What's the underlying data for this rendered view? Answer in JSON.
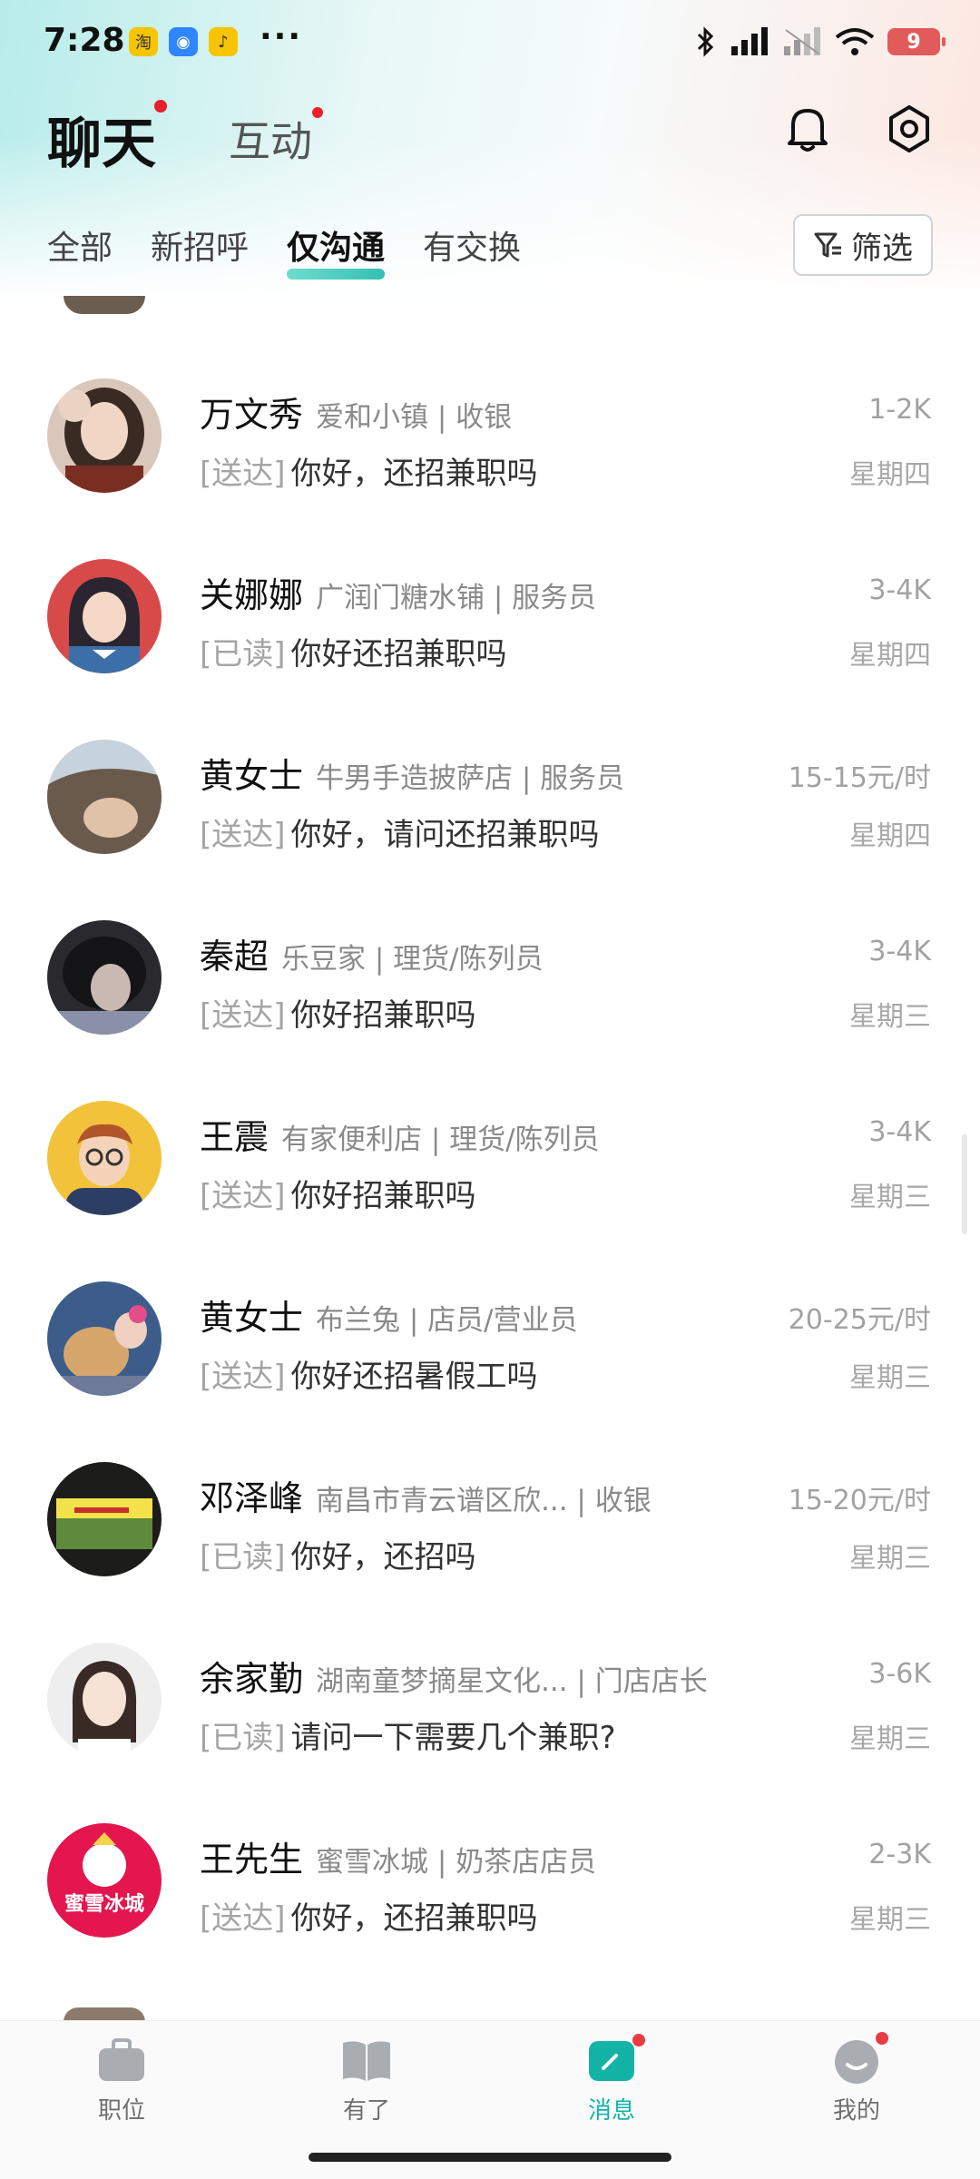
{
  "status_bar": {
    "time": "7:28",
    "apps": [
      {
        "icon": "taobao-icon",
        "label": "淘",
        "color": "#f7c400"
      },
      {
        "icon": "message-app-icon",
        "label": "◉",
        "color": "#2f86ff"
      },
      {
        "icon": "music-app-icon",
        "label": "♪",
        "color": "#f7c400"
      }
    ],
    "more": "···",
    "battery": "9"
  },
  "header": {
    "title": "聊天",
    "secondary_title": "互动",
    "bell_icon": "bell-icon",
    "settings_icon": "settings-icon"
  },
  "tabs": [
    "全部",
    "新招呼",
    "仅沟通",
    "有交换"
  ],
  "active_tab": 2,
  "filter": {
    "label": "筛选",
    "icon": "filter-icon"
  },
  "conversations": [
    {
      "name": "万文秀",
      "org": "爱和小镇 | 收银",
      "salary": "1-2K",
      "status": "[送达]",
      "message": "你好，还招兼职吗",
      "day": "星期四",
      "avatar": "photo-woman"
    },
    {
      "name": "关娜娜",
      "org": "广润门糖水铺 | 服务员",
      "salary": "3-4K",
      "status": "[已读]",
      "message": "你好还招兼职吗",
      "day": "星期四",
      "avatar": "illustrated-woman"
    },
    {
      "name": "黄女士",
      "org": "牛男手造披萨店 | 服务员",
      "salary": "15-15元/时",
      "status": "[送达]",
      "message": "你好，请问还招兼职吗",
      "day": "星期四",
      "avatar": "photo-hair"
    },
    {
      "name": "秦超",
      "org": "乐豆家 | 理货/陈列员",
      "salary": "3-4K",
      "status": "[送达]",
      "message": "你好招兼职吗",
      "day": "星期三",
      "avatar": "photo-dark"
    },
    {
      "name": "王震",
      "org": "有家便利店 | 理货/陈列员",
      "salary": "3-4K",
      "status": "[送达]",
      "message": "你好招兼职吗",
      "day": "星期三",
      "avatar": "illustrated-man"
    },
    {
      "name": "黄女士",
      "org": "布兰兔 | 店员/营业员",
      "salary": "20-25元/时",
      "status": "[送达]",
      "message": "你好还招暑假工吗",
      "day": "星期三",
      "avatar": "photo-kids"
    },
    {
      "name": "邓泽峰",
      "org": "南昌市青云谱区欣... | 收银",
      "salary": "15-20元/时",
      "status": "[已读]",
      "message": "你好，还招吗",
      "day": "星期三",
      "avatar": "photo-store"
    },
    {
      "name": "余家勤",
      "org": "湖南童梦摘星文化... | 门店店长",
      "salary": "3-6K",
      "status": "[已读]",
      "message": "请问一下需要几个兼职?",
      "day": "星期三",
      "avatar": "photo-girl"
    },
    {
      "name": "王先生",
      "org": "蜜雪冰城 | 奶茶店店员",
      "salary": "2-3K",
      "status": "[送达]",
      "message": "你好，还招兼职吗",
      "day": "星期三",
      "avatar": "brand-logo",
      "avatar_text": "蜜雪冰城"
    }
  ],
  "bottom_nav": [
    {
      "label": "职位",
      "icon": "briefcase-icon"
    },
    {
      "label": "有了",
      "icon": "book-icon"
    },
    {
      "label": "消息",
      "icon": "message-icon",
      "active": true,
      "badge": true
    },
    {
      "label": "我的",
      "icon": "profile-icon",
      "badge": true
    }
  ],
  "colors": {
    "accent": "#13b3a6",
    "badge": "#e8202a"
  }
}
